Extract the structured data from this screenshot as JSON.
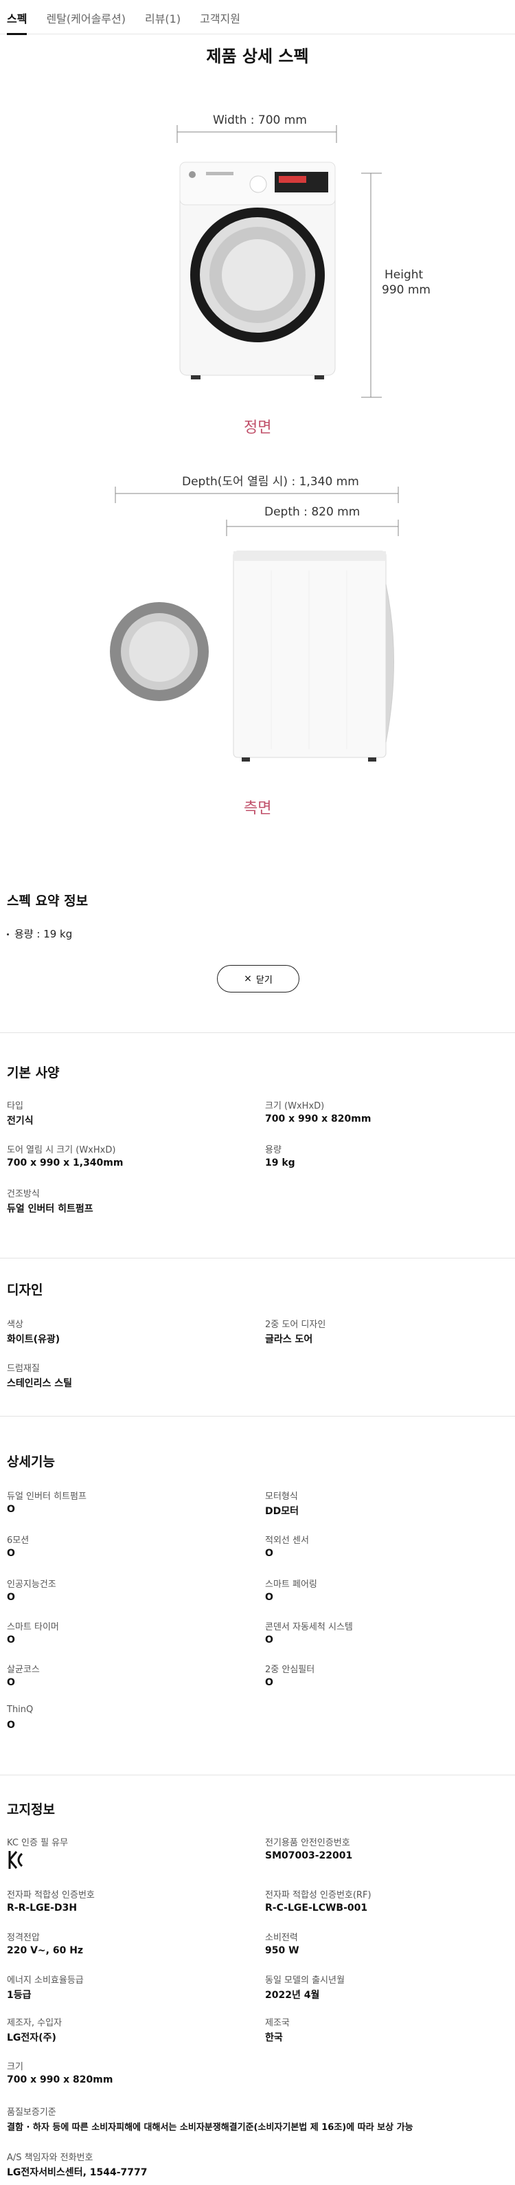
{
  "tabs": [
    {
      "label": "스펙",
      "active": true
    },
    {
      "label": "렌탈(케어솔루션)",
      "active": false
    },
    {
      "label": "리뷰(1)",
      "active": false
    },
    {
      "label": "고객지원",
      "active": false
    }
  ],
  "page_title": "제품 상세 스펙",
  "front_view": {
    "width_label": "Width : 700 mm",
    "height_label_line1": "Height",
    "height_label_line2": "990 mm",
    "caption": "정면"
  },
  "side_view": {
    "depth_open_label": "Depth(도어 열림 시) : 1,340 mm",
    "depth_label": "Depth : 820 mm",
    "caption": "측면"
  },
  "summary": {
    "title": "스펙 요약 정보",
    "item": "용량 : 19 kg",
    "close_label": "닫기"
  },
  "basic": {
    "title": "기본 사양",
    "items": [
      {
        "label": "타입",
        "value": "전기식"
      },
      {
        "label": "크기 (WxHxD)",
        "value": "700 x 990 x 820mm"
      },
      {
        "label": "도어 열림 시 크기 (WxHxD)",
        "value": "700 x 990 x 1,340mm"
      },
      {
        "label": "용량",
        "value": "19 kg"
      },
      {
        "label": "건조방식",
        "value": "듀얼 인버터 히트펌프"
      }
    ]
  },
  "design": {
    "title": "디자인",
    "items": [
      {
        "label": "색상",
        "value": "화이트(유광)"
      },
      {
        "label": "2중 도어 디자인",
        "value": "글라스 도어"
      },
      {
        "label": "드럼재질",
        "value": "스테인리스 스틸"
      }
    ]
  },
  "features": {
    "title": "상세기능",
    "items": [
      {
        "label": "듀얼 인버터 히트펌프",
        "value": "O"
      },
      {
        "label": "모터형식",
        "value": "DD모터"
      },
      {
        "label": "6모션",
        "value": "O"
      },
      {
        "label": "적외선 센서",
        "value": "O"
      },
      {
        "label": "인공지능건조",
        "value": "O"
      },
      {
        "label": "스마트 페어링",
        "value": "O"
      },
      {
        "label": "스마트 타이머",
        "value": "O"
      },
      {
        "label": "콘덴서 자동세척 시스템",
        "value": "O"
      },
      {
        "label": "살균코스",
        "value": "O"
      },
      {
        "label": "2중 안심필터",
        "value": "O"
      },
      {
        "label": "ThinQ",
        "value": "O"
      }
    ]
  },
  "notice": {
    "title": "고지정보",
    "items": [
      {
        "label": "KC 인증 필 유무",
        "value": ""
      },
      {
        "label": "전기용품 안전인증번호",
        "value": "SM07003-22001"
      },
      {
        "label": "전자파 적합성 인증번호",
        "value": "R-R-LGE-D3H"
      },
      {
        "label": "전자파 적합성 인증번호(RF)",
        "value": "R-C-LGE-LCWB-001"
      },
      {
        "label": "정격전압",
        "value": "220 V~, 60 Hz"
      },
      {
        "label": "소비전력",
        "value": "950 W"
      },
      {
        "label": "에너지 소비효율등급",
        "value": "1등급"
      },
      {
        "label": "동일 모델의 출시년월",
        "value": "2022년 4월"
      },
      {
        "label": "제조자, 수입자",
        "value": "LG전자(주)"
      },
      {
        "label": "제조국",
        "value": "한국"
      },
      {
        "label": "크기",
        "value": "700 x 990 x 820mm"
      },
      {
        "label": "품질보증기준",
        "value": "결함 · 하자 등에 따른 소비자피해에 대해서는 소비자분쟁해결기준(소비자기본법 제 16조)에 따라 보상 가능"
      },
      {
        "label": "A/S 책임자와 전화번호",
        "value": "LG전자서비스센터, 1544-7777"
      }
    ]
  },
  "colors": {
    "accent_caption": "#c0506a",
    "door_ring": "#1a1a1a",
    "door_gray": "#8a8a8a"
  },
  "icons": [
    "kc-mark-icon",
    "close-icon"
  ]
}
